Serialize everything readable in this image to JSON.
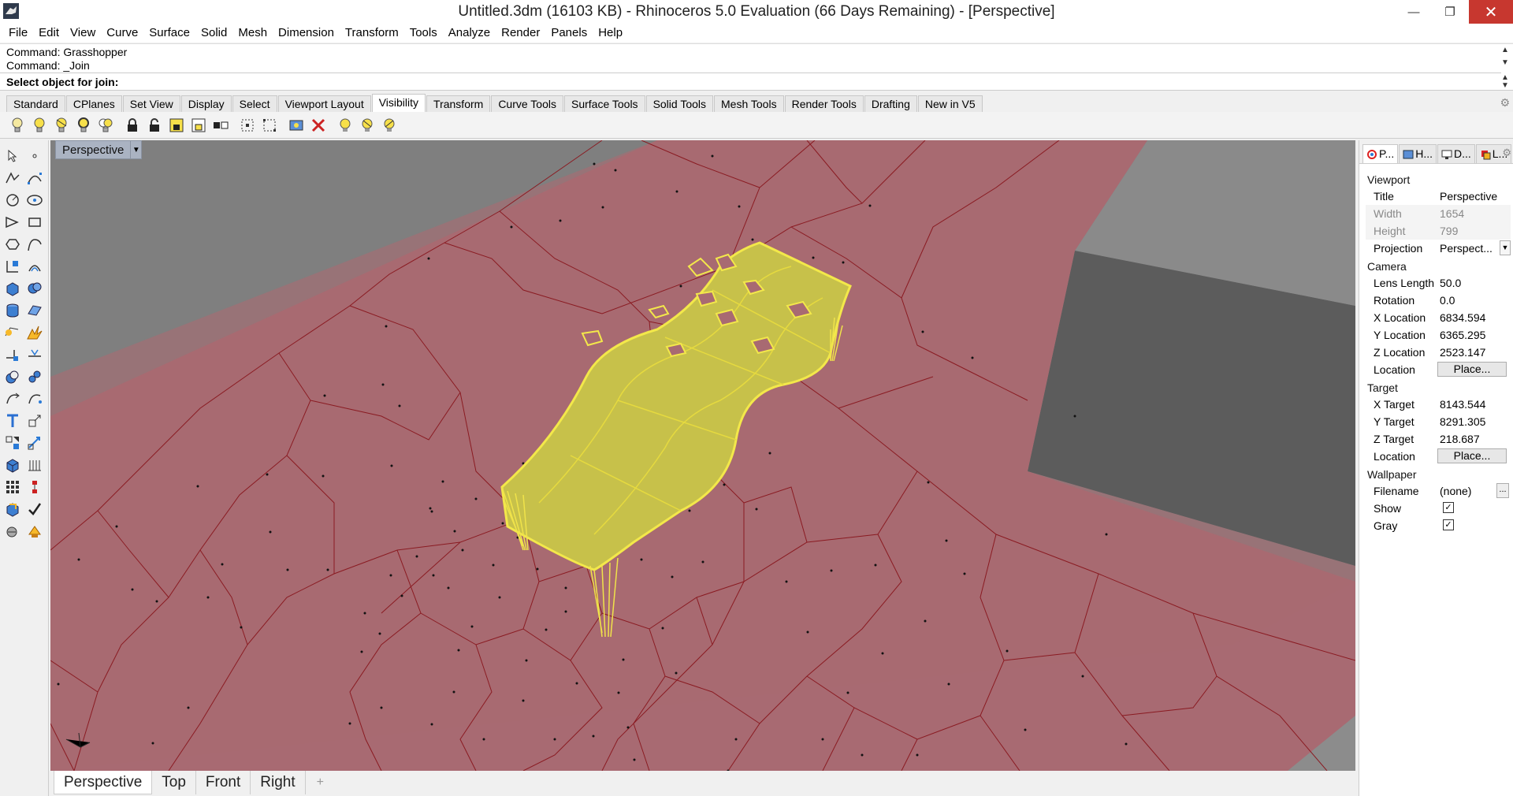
{
  "window": {
    "title": "Untitled.3dm (16103 KB) - Rhinoceros 5.0 Evaluation (66 Days Remaining) - [Perspective]",
    "minimize": "—",
    "maximize": "❐",
    "close": "✕"
  },
  "menu": [
    "File",
    "Edit",
    "View",
    "Curve",
    "Surface",
    "Solid",
    "Mesh",
    "Dimension",
    "Transform",
    "Tools",
    "Analyze",
    "Render",
    "Panels",
    "Help"
  ],
  "command": {
    "history": [
      "Command: Grasshopper",
      "Command: _Join"
    ],
    "prompt": "Select object for join:",
    "input_value": ""
  },
  "toolbar_tabs": {
    "items": [
      "Standard",
      "CPlanes",
      "Set View",
      "Display",
      "Select",
      "Viewport Layout",
      "Visibility",
      "Transform",
      "Curve Tools",
      "Surface Tools",
      "Solid Tools",
      "Mesh Tools",
      "Render Tools",
      "Drafting",
      "New in V5"
    ],
    "active": "Visibility"
  },
  "viewport": {
    "label": "Perspective",
    "tabs": [
      "Perspective",
      "Top",
      "Front",
      "Right"
    ],
    "active_tab": "Perspective",
    "add_tab": "+",
    "colors": {
      "ground": "#a86a72",
      "edges": "#8a1b22",
      "surface": "#c9c24a",
      "surface_outline": "#f0e34a",
      "box": "#6e6e6e",
      "background": "#7f7f7f"
    }
  },
  "properties_panel": {
    "tabs": [
      "P...",
      "H...",
      "D...",
      "L..."
    ],
    "viewport_section": "Viewport",
    "title_label": "Title",
    "title_value": "Perspective",
    "width_label": "Width",
    "width_value": "1654",
    "height_label": "Height",
    "height_value": "799",
    "projection_label": "Projection",
    "projection_value": "Perspect...",
    "camera_section": "Camera",
    "lens_label": "Lens Length",
    "lens_value": "50.0",
    "rotation_label": "Rotation",
    "rotation_value": "0.0",
    "xloc_label": "X Location",
    "xloc_value": "6834.594",
    "yloc_label": "Y Location",
    "yloc_value": "6365.295",
    "zloc_label": "Z Location",
    "zloc_value": "2523.147",
    "cam_location_label": "Location",
    "place_button": "Place...",
    "target_section": "Target",
    "xt_label": "X Target",
    "xt_value": "8143.544",
    "yt_label": "Y Target",
    "yt_value": "8291.305",
    "zt_label": "Z Target",
    "zt_value": "218.687",
    "target_location_label": "Location",
    "wallpaper_section": "Wallpaper",
    "filename_label": "Filename",
    "filename_value": "(none)",
    "filename_button": "...",
    "show_label": "Show",
    "show_checked": "✓",
    "gray_label": "Gray",
    "gray_checked": "✓"
  }
}
